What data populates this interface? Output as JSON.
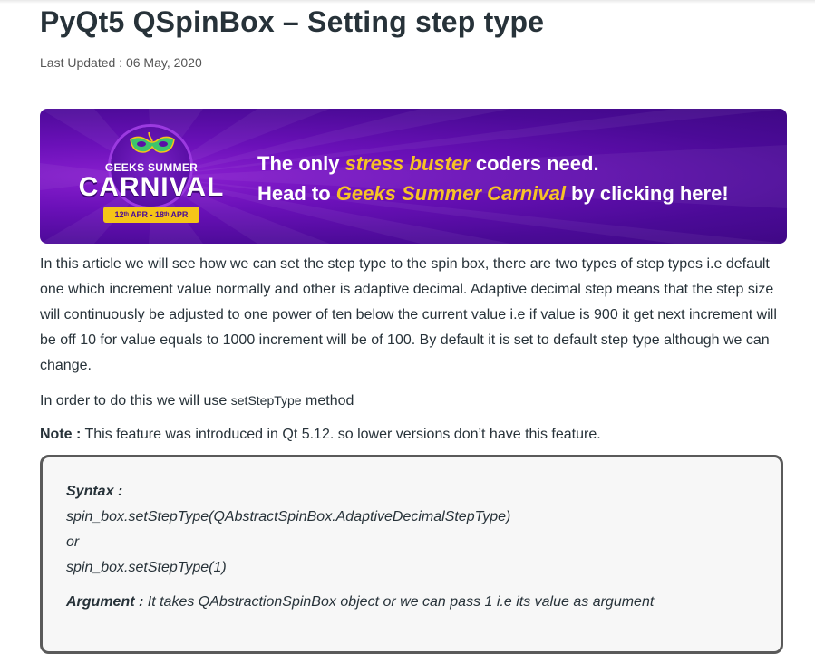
{
  "article": {
    "title": "PyQt5 QSpinBox – Setting step type",
    "last_updated": "Last Updated : 06 May, 2020",
    "para1": "In this article we will see how we can set the step type to the spin box, there are two types of step types i.e default one which increment value normally and other is adaptive decimal. Adaptive decimal step means that the step size will continuously be adjusted to one power of ten below the current value i.e if value is 900 it get next increment will be off 10 for value equals to 1000 increment will be of 100. By default it is set to default step type although we can change.",
    "para2_prefix": "In order to do this we will use ",
    "para2_code": "setStepType",
    "para2_suffix": " method",
    "note_label": "Note :",
    "note_text": " This feature was introduced in Qt 5.12. so lower versions don’t have this feature."
  },
  "banner": {
    "badge_top": "GEEKS SUMMER",
    "badge_main": "CARNIVAL",
    "badge_dates": "12ᵗʰ APR - 18ᵗʰ APR",
    "line1_prefix": "The only ",
    "line1_highlight": "stress buster",
    "line1_suffix": " coders need.",
    "line2_prefix": "Head to ",
    "line2_highlight": "Geeks Summer Carnival",
    "line2_suffix": " by clicking here!",
    "bg_color": "#5a0fa6",
    "highlight_color": "#f7c325"
  },
  "syntax": {
    "label": "Syntax :",
    "line1": "spin_box.setStepType(QAbstractSpinBox.AdaptiveDecimalStepType)",
    "line2": "or",
    "line3": "spin_box.setStepType(1)",
    "argument_label": "Argument :",
    "argument_text": " It takes QAbstractionSpinBox object or we can pass 1 i.e its value as argument"
  }
}
